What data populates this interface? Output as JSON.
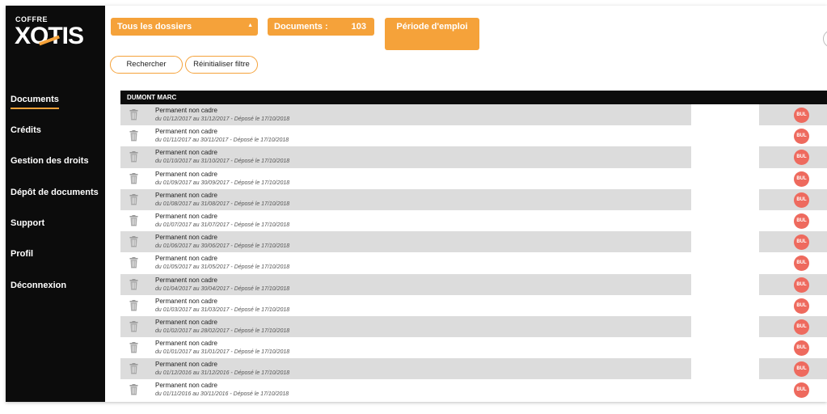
{
  "logo": {
    "small": "COFFRE",
    "big": "XOTIS"
  },
  "sidebar": {
    "items": [
      {
        "label": "Documents",
        "active": true
      },
      {
        "label": "Crédits"
      },
      {
        "label": "Gestion des droits"
      },
      {
        "label": "Dépôt de documents"
      },
      {
        "label": "Support"
      },
      {
        "label": "Profil"
      },
      {
        "label": "Déconnexion"
      }
    ]
  },
  "filters": {
    "folder_select": "Tous les dossiers",
    "documents_label": "Documents :",
    "documents_count": "103",
    "period_button": "Période d'emploi",
    "search_button": "Rechercher",
    "reset_button": "Réinitialiser filtre"
  },
  "table": {
    "group_name": "DUMONT MARC",
    "badge_label": "BUL",
    "rows": [
      {
        "title": "Permanent non cadre",
        "subtitle": "du 01/12/2017 au 31/12/2017 - Déposé le 17/10/2018"
      },
      {
        "title": "Permanent non cadre",
        "subtitle": "du 01/11/2017 au 30/11/2017 - Déposé le 17/10/2018"
      },
      {
        "title": "Permanent non cadre",
        "subtitle": "du 01/10/2017 au 31/10/2017 - Déposé le 17/10/2018"
      },
      {
        "title": "Permanent non cadre",
        "subtitle": "du 01/09/2017 au 30/09/2017 - Déposé le 17/10/2018"
      },
      {
        "title": "Permanent non cadre",
        "subtitle": "du 01/08/2017 au 31/08/2017 - Déposé le 17/10/2018"
      },
      {
        "title": "Permanent non cadre",
        "subtitle": "du 01/07/2017 au 31/07/2017 - Déposé le 17/10/2018"
      },
      {
        "title": "Permanent non cadre",
        "subtitle": "du 01/06/2017 au 30/06/2017 - Déposé le 17/10/2018"
      },
      {
        "title": "Permanent non cadre",
        "subtitle": "du 01/05/2017 au 31/05/2017 - Déposé le 17/10/2018"
      },
      {
        "title": "Permanent non cadre",
        "subtitle": "du 01/04/2017 au 30/04/2017 - Déposé le 17/10/2018"
      },
      {
        "title": "Permanent non cadre",
        "subtitle": "du 01/03/2017 au 31/03/2017 - Déposé le 17/10/2018"
      },
      {
        "title": "Permanent non cadre",
        "subtitle": "du 01/02/2017 au 28/02/2017 - Déposé le 17/10/2018"
      },
      {
        "title": "Permanent non cadre",
        "subtitle": "du 01/01/2017 au 31/01/2017 - Déposé le 17/10/2018"
      },
      {
        "title": "Permanent non cadre",
        "subtitle": "du 01/12/2016 au 31/12/2016 - Déposé le 17/10/2018"
      },
      {
        "title": "Permanent non cadre",
        "subtitle": "du 01/11/2016 au 30/11/2016 - Déposé le 17/10/2018"
      }
    ]
  },
  "icons": {
    "row_action": "trash-icon",
    "select_caret": "caret-up-icon"
  },
  "colors": {
    "accent": "#f5a23a",
    "sidebar_bg": "#0c0c0c",
    "badge": "#ee6a5e",
    "row_alt": "#dcdcdc"
  }
}
